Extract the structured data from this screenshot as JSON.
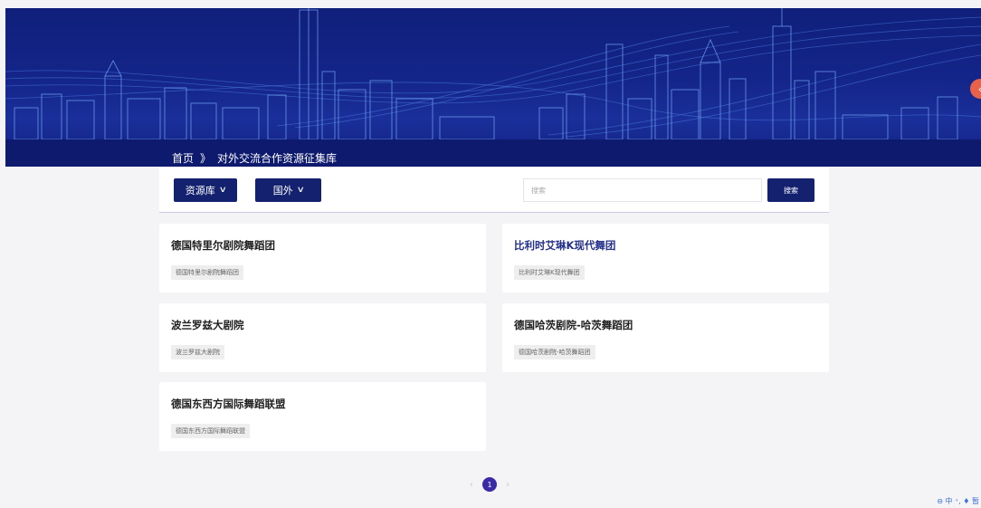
{
  "breadcrumb": {
    "home": "首页",
    "separator": "》",
    "current": "对外交流合作资源征集库"
  },
  "filters": {
    "library_label": "资源库",
    "region_label": "国外",
    "chevron": "∨"
  },
  "search": {
    "placeholder": "搜索",
    "button_label": "搜索"
  },
  "cards": [
    {
      "title": "德国特里尔剧院舞蹈团",
      "tag": "德国特里尔剧院舞蹈团"
    },
    {
      "title": "比利时艾琳K现代舞团",
      "tag": "比利时艾琳K现代舞团"
    },
    {
      "title": "波兰罗兹大剧院",
      "tag": "波兰罗兹大剧院"
    },
    {
      "title": "德国哈茨剧院-哈茨舞蹈团",
      "tag": "德国哈茨剧院-哈茨舞蹈团"
    },
    {
      "title": "德国东西方国际舞蹈联盟",
      "tag": "德国东西方国际舞蹈联盟"
    }
  ],
  "pagination": {
    "prev": "‹",
    "current_page": "1",
    "next": "›"
  },
  "corner_tools": {
    "label": "⊖ 中 ⁺, ♦ 暂"
  },
  "colors": {
    "brand_navy": "#14216e",
    "banner_blue": "#14258a",
    "accent_purple": "#3b2aa5",
    "badge_orange": "#e8624b"
  }
}
